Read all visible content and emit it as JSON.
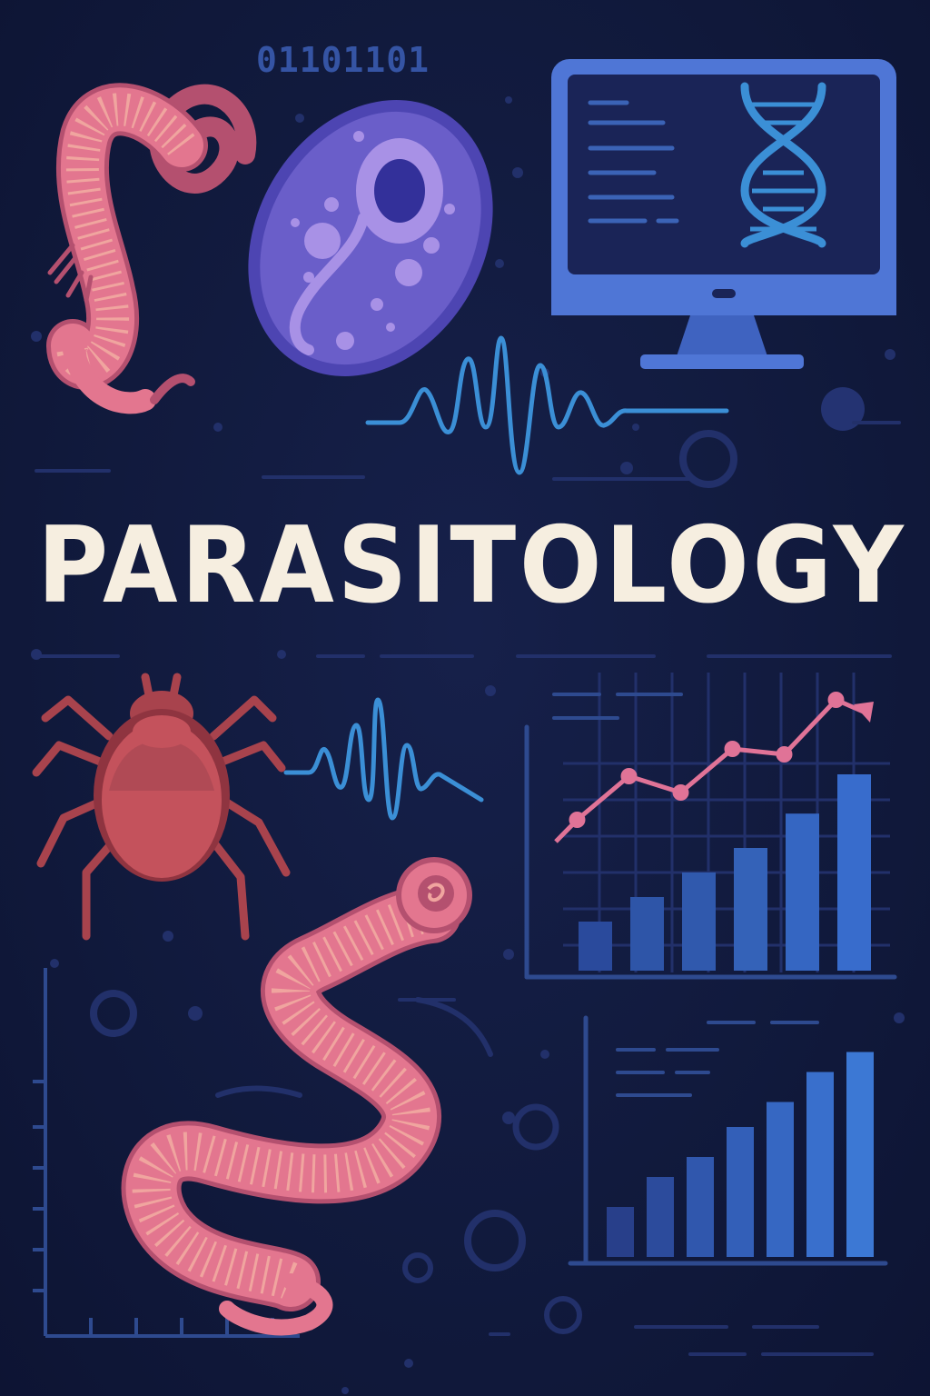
{
  "binary_text": "01101101",
  "title": "PARASITOLOGY",
  "colors": {
    "background": "#111a3d",
    "worm_pink": "#e3768f",
    "worm_pink_dark": "#b4506f",
    "cell_purple": "#6a5ec9",
    "monitor_blue": "#4f76d6",
    "wave_blue": "#3b8fd6",
    "tick_red": "#a8434d",
    "bar_blue": "#2e55a8",
    "trend_pink": "#e07397",
    "title_cream": "#f6eee0"
  },
  "icons": [
    "worm-icon",
    "protozoan-cell-icon",
    "computer-monitor-icon",
    "dna-icon",
    "heartbeat-wave-icon",
    "tick-icon",
    "line-bar-chart-icon",
    "bar-chart-icon"
  ],
  "chart_data": [
    {
      "type": "bar",
      "categories": [
        "",
        "",
        "",
        "",
        "",
        ""
      ],
      "series": [
        {
          "values": [
            1.0,
            1.5,
            2.0,
            2.5,
            3.2,
            4.0
          ]
        },
        {
          "values": [
            1.6,
            2.4,
            2.1,
            2.9,
            2.8,
            3.8
          ]
        }
      ],
      "title": "",
      "xlabel": "",
      "ylabel": ""
    },
    {
      "type": "bar",
      "categories": [
        "",
        "",
        "",
        "",
        "",
        "",
        ""
      ],
      "values": [
        1.0,
        1.6,
        2.0,
        2.6,
        3.1,
        3.7,
        4.1
      ],
      "title": "",
      "xlabel": "",
      "ylabel": ""
    }
  ]
}
